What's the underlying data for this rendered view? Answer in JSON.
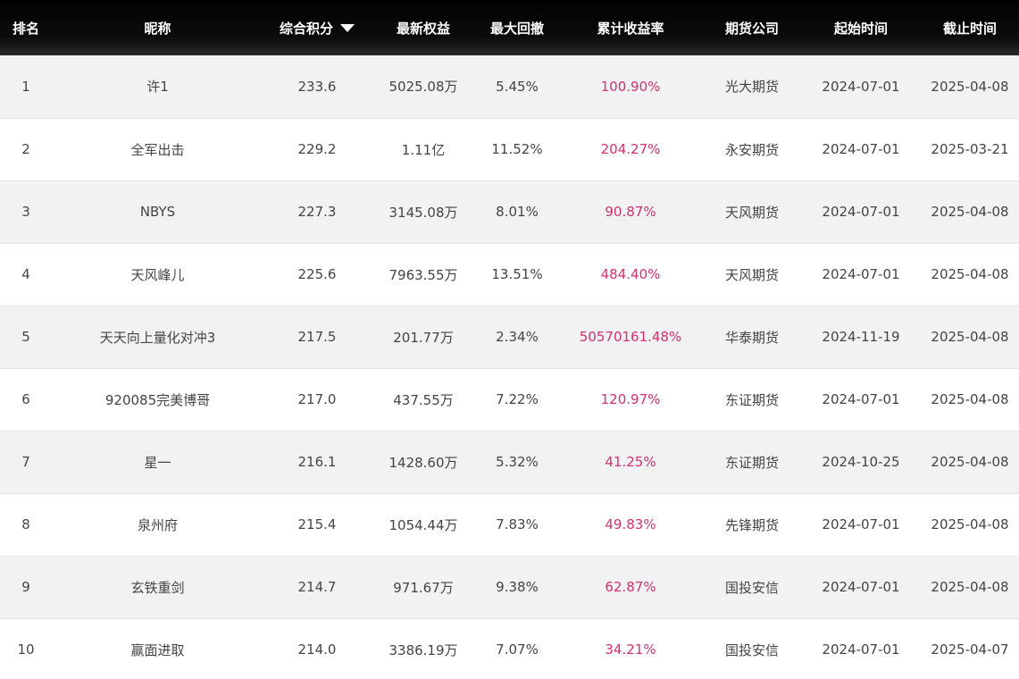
{
  "header": {
    "rank": "排名",
    "nickname": "昵称",
    "score": "综合积分",
    "equity": "最新权益",
    "drawdown": "最大回撤",
    "cum_return": "累计收益率",
    "firm": "期货公司",
    "start": "起始时间",
    "end": "截止时间"
  },
  "colors": {
    "header_bg": "#000000",
    "return_text": "#d6306f",
    "row_alt": "#f2f2f2"
  },
  "rows": [
    {
      "rank": "1",
      "nickname": "许1",
      "score": "233.6",
      "equity": "5025.08万",
      "drawdown": "5.45%",
      "cum_return": "100.90%",
      "firm": "光大期货",
      "start": "2024-07-01",
      "end": "2025-04-08"
    },
    {
      "rank": "2",
      "nickname": "全军出击",
      "score": "229.2",
      "equity": "1.11亿",
      "drawdown": "11.52%",
      "cum_return": "204.27%",
      "firm": "永安期货",
      "start": "2024-07-01",
      "end": "2025-03-21"
    },
    {
      "rank": "3",
      "nickname": "NBYS",
      "score": "227.3",
      "equity": "3145.08万",
      "drawdown": "8.01%",
      "cum_return": "90.87%",
      "firm": "天风期货",
      "start": "2024-07-01",
      "end": "2025-04-08"
    },
    {
      "rank": "4",
      "nickname": "天风峰儿",
      "score": "225.6",
      "equity": "7963.55万",
      "drawdown": "13.51%",
      "cum_return": "484.40%",
      "firm": "天风期货",
      "start": "2024-07-01",
      "end": "2025-04-08"
    },
    {
      "rank": "5",
      "nickname": "天天向上量化对冲3",
      "score": "217.5",
      "equity": "201.77万",
      "drawdown": "2.34%",
      "cum_return": "50570161.48%",
      "firm": "华泰期货",
      "start": "2024-11-19",
      "end": "2025-04-08"
    },
    {
      "rank": "6",
      "nickname": "920085完美博哥",
      "score": "217.0",
      "equity": "437.55万",
      "drawdown": "7.22%",
      "cum_return": "120.97%",
      "firm": "东证期货",
      "start": "2024-07-01",
      "end": "2025-04-08"
    },
    {
      "rank": "7",
      "nickname": "星一",
      "score": "216.1",
      "equity": "1428.60万",
      "drawdown": "5.32%",
      "cum_return": "41.25%",
      "firm": "东证期货",
      "start": "2024-10-25",
      "end": "2025-04-08"
    },
    {
      "rank": "8",
      "nickname": "泉州府",
      "score": "215.4",
      "equity": "1054.44万",
      "drawdown": "7.83%",
      "cum_return": "49.83%",
      "firm": "先锋期货",
      "start": "2024-07-01",
      "end": "2025-04-08"
    },
    {
      "rank": "9",
      "nickname": "玄铁重剑",
      "score": "214.7",
      "equity": "971.67万",
      "drawdown": "9.38%",
      "cum_return": "62.87%",
      "firm": "国投安信",
      "start": "2024-07-01",
      "end": "2025-04-08"
    },
    {
      "rank": "10",
      "nickname": "赢面进取",
      "score": "214.0",
      "equity": "3386.19万",
      "drawdown": "7.07%",
      "cum_return": "34.21%",
      "firm": "国投安信",
      "start": "2024-07-01",
      "end": "2025-04-07"
    }
  ]
}
